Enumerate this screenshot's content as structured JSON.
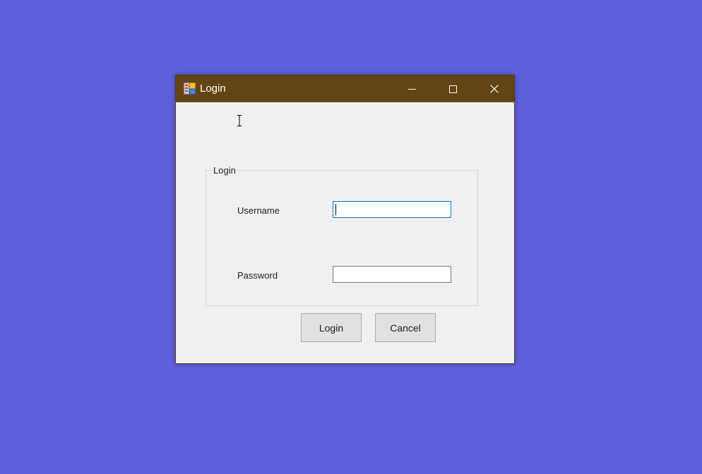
{
  "window": {
    "title": "Login",
    "app_icon": "form-app-icon",
    "controls": {
      "minimize_icon": "minimize-icon",
      "maximize_icon": "maximize-icon",
      "close_icon": "close-icon"
    }
  },
  "groupbox": {
    "legend": "Login"
  },
  "fields": {
    "username": {
      "label": "Username",
      "value": ""
    },
    "password": {
      "label": "Password",
      "value": ""
    }
  },
  "buttons": {
    "login_label": "Login",
    "cancel_label": "Cancel"
  },
  "colors": {
    "desktop": "#5f5fdb",
    "titlebar": "#634413",
    "window_body": "#f0f0f0",
    "focus_border": "#0078d7"
  }
}
